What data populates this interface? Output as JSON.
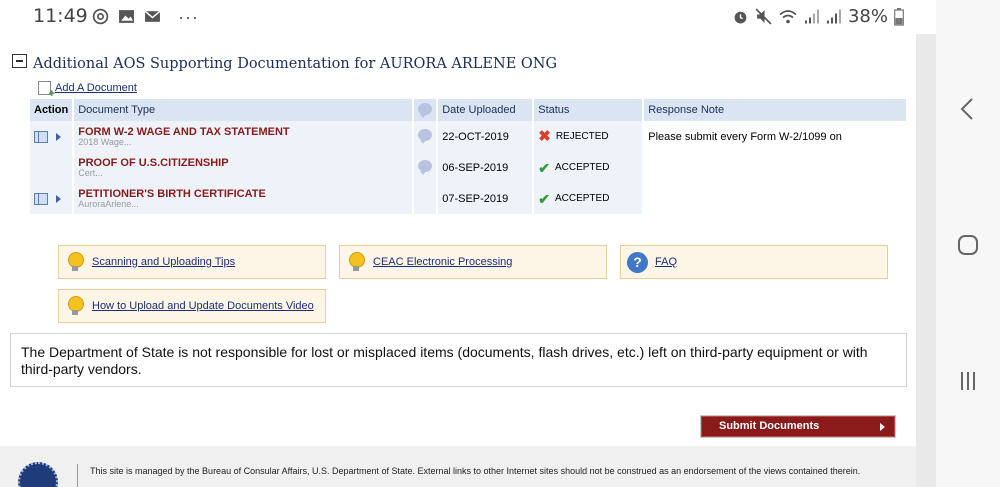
{
  "status_bar": {
    "time": "11:49",
    "left_icons": [
      "podcast-icon",
      "image-icon",
      "mail-icon"
    ],
    "overflow": "···",
    "battery": "38%"
  },
  "section": {
    "title": "Additional AOS Supporting Documentation for AURORA ARLENE ONG",
    "add_link": "Add A Document"
  },
  "table": {
    "headers": {
      "action": "Action",
      "document_type": "Document Type",
      "date_uploaded": "Date Uploaded",
      "status": "Status",
      "response_note": "Response Note"
    },
    "rows": [
      {
        "title": "FORM W-2 WAGE AND TAX STATEMENT",
        "subtitle": "2018 Wage...",
        "date": "22-OCT-2019",
        "status": "REJECTED",
        "response": "Please submit every Form W-2/1099 on"
      },
      {
        "title": "PROOF OF U.S.CITIZENSHIP",
        "subtitle": "Cert...",
        "date": "06-SEP-2019",
        "status": "ACCEPTED",
        "response": ""
      },
      {
        "title": "PETITIONER'S BIRTH CERTIFICATE",
        "subtitle": "AuroraArlene...",
        "date": "07-SEP-2019",
        "status": "ACCEPTED",
        "response": ""
      }
    ]
  },
  "tips": {
    "scanning": "Scanning and Uploading Tips",
    "ceac": "CEAC Electronic Processing",
    "faq": "FAQ",
    "video": "How to Upload and Update Documents Video"
  },
  "notice": "The Department of State is not responsible for lost or misplaced items (documents, flash drives, etc.) left on third-party equipment or with third-party vendors.",
  "submit_label": "Submit Documents",
  "footer_text": "This site is managed by the Bureau of Consular Affairs, U.S. Department of State. External links to other Internet sites should not be construed as an endorsement of the views contained therein.",
  "colors": {
    "accent": "#8b1a1a",
    "header_bg": "#dbe4f2",
    "link": "#1c2e7a"
  }
}
